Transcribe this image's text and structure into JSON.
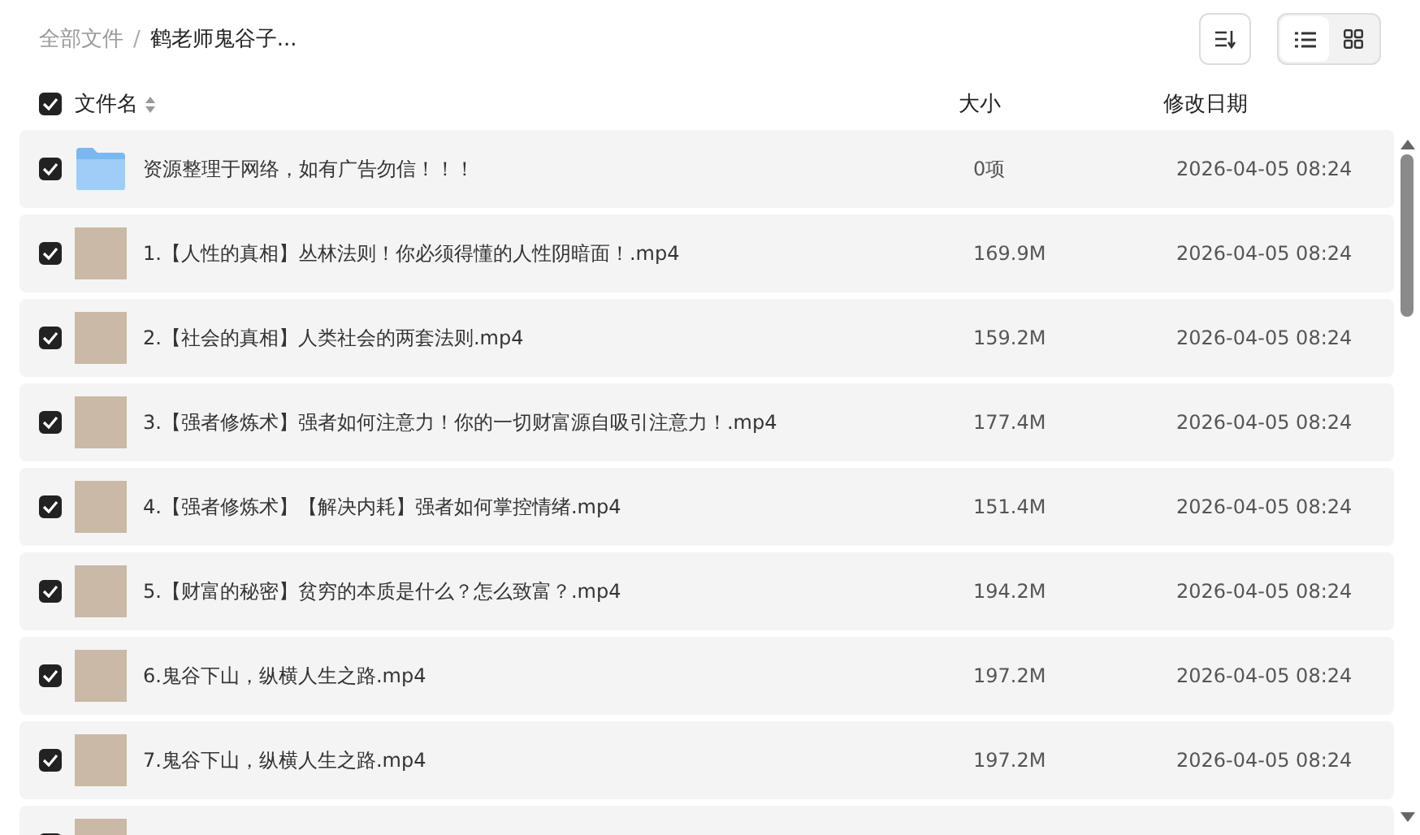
{
  "breadcrumb_separator": "/",
  "breadcrumb": [
    {
      "label": "全部文件",
      "current": false
    },
    {
      "label": "鹤老师鬼谷子...",
      "current": true
    }
  ],
  "view_toggle": [
    {
      "kind": "list",
      "selected": true
    },
    {
      "kind": "grid",
      "selected": false
    }
  ],
  "table": {
    "all_checked": true,
    "columns": [
      "文件名",
      "大小",
      "修改日期"
    ],
    "rows": [
      {
        "kind": "folder",
        "checked": true,
        "name": "资源整理于网络，如有广告勿信！！！",
        "size": "0项",
        "date": "2026-04-05 08:24"
      },
      {
        "kind": "video",
        "checked": true,
        "name": "1.【人性的真相】丛林法则！你必须得懂的人性阴暗面！.mp4",
        "size": "169.9M",
        "date": "2026-04-05 08:24"
      },
      {
        "kind": "video",
        "checked": true,
        "name": "2.【社会的真相】人类社会的两套法则.mp4",
        "size": "159.2M",
        "date": "2026-04-05 08:24"
      },
      {
        "kind": "video",
        "checked": true,
        "name": "3.【强者修炼术】强者如何注意力！你的一切财富源自吸引注意力！.mp4",
        "size": "177.4M",
        "date": "2026-04-05 08:24"
      },
      {
        "kind": "video",
        "checked": true,
        "name": "4.【强者修炼术】【解决内耗】强者如何掌控情绪.mp4",
        "size": "151.4M",
        "date": "2026-04-05 08:24"
      },
      {
        "kind": "video",
        "checked": true,
        "name": "5.【财富的秘密】贫穷的本质是什么？怎么致富？.mp4",
        "size": "194.2M",
        "date": "2026-04-05 08:24"
      },
      {
        "kind": "video",
        "checked": true,
        "name": "6.鬼谷下山，纵横人生之路.mp4",
        "size": "197.2M",
        "date": "2026-04-05 08:24"
      },
      {
        "kind": "video",
        "checked": true,
        "name": "7.鬼谷下山，纵横人生之路.mp4",
        "size": "197.2M",
        "date": "2026-04-05 08:24"
      },
      {
        "kind": "video",
        "checked": true
      }
    ]
  }
}
